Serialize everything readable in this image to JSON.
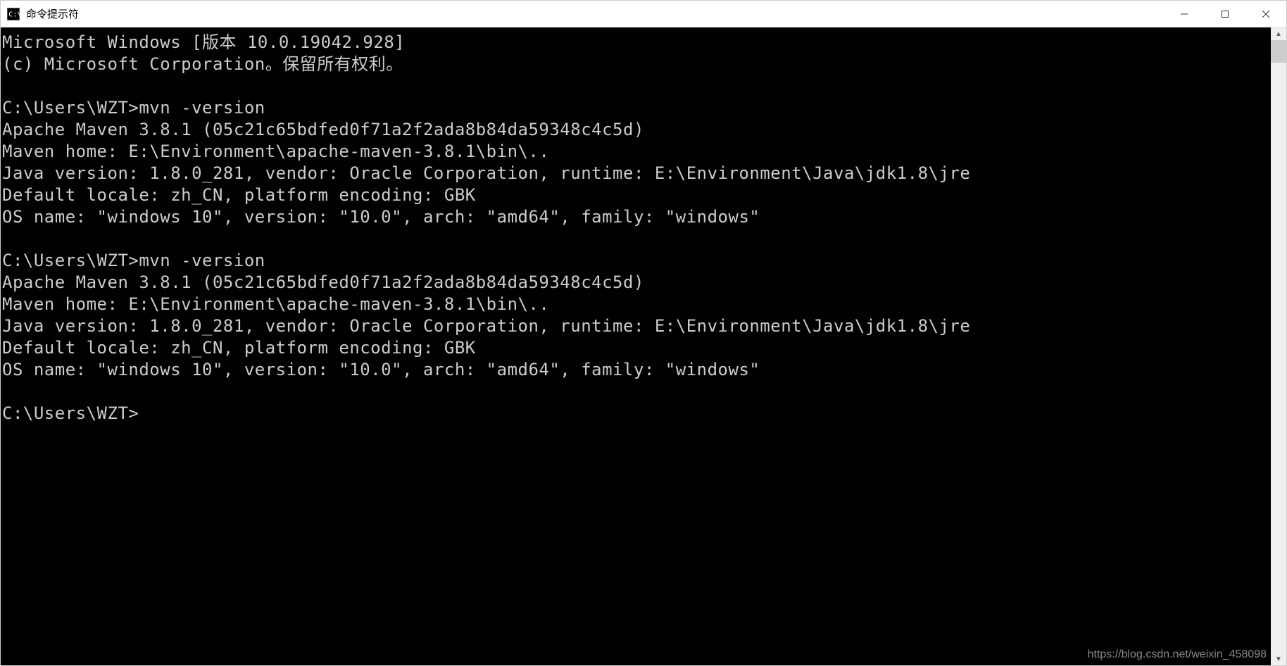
{
  "titlebar": {
    "title": "命令提示符"
  },
  "terminal": {
    "header_line1": "Microsoft Windows [版本 10.0.19042.928]",
    "header_line2": "(c) Microsoft Corporation。保留所有权利。",
    "prompt1": "C:\\Users\\WZT>mvn -version",
    "block1_line1": "Apache Maven 3.8.1 (05c21c65bdfed0f71a2f2ada8b84da59348c4c5d)",
    "block1_line2": "Maven home: E:\\Environment\\apache-maven-3.8.1\\bin\\..",
    "block1_line3": "Java version: 1.8.0_281, vendor: Oracle Corporation, runtime: E:\\Environment\\Java\\jdk1.8\\jre",
    "block1_line4": "Default locale: zh_CN, platform encoding: GBK",
    "block1_line5": "OS name: \"windows 10\", version: \"10.0\", arch: \"amd64\", family: \"windows\"",
    "prompt2": "C:\\Users\\WZT>mvn -version",
    "block2_line1": "Apache Maven 3.8.1 (05c21c65bdfed0f71a2f2ada8b84da59348c4c5d)",
    "block2_line2": "Maven home: E:\\Environment\\apache-maven-3.8.1\\bin\\..",
    "block2_line3": "Java version: 1.8.0_281, vendor: Oracle Corporation, runtime: E:\\Environment\\Java\\jdk1.8\\jre",
    "block2_line4": "Default locale: zh_CN, platform encoding: GBK",
    "block2_line5": "OS name: \"windows 10\", version: \"10.0\", arch: \"amd64\", family: \"windows\"",
    "prompt3": "C:\\Users\\WZT>"
  },
  "watermark": {
    "text": "https://blog.csdn.net/weixin_458098"
  }
}
